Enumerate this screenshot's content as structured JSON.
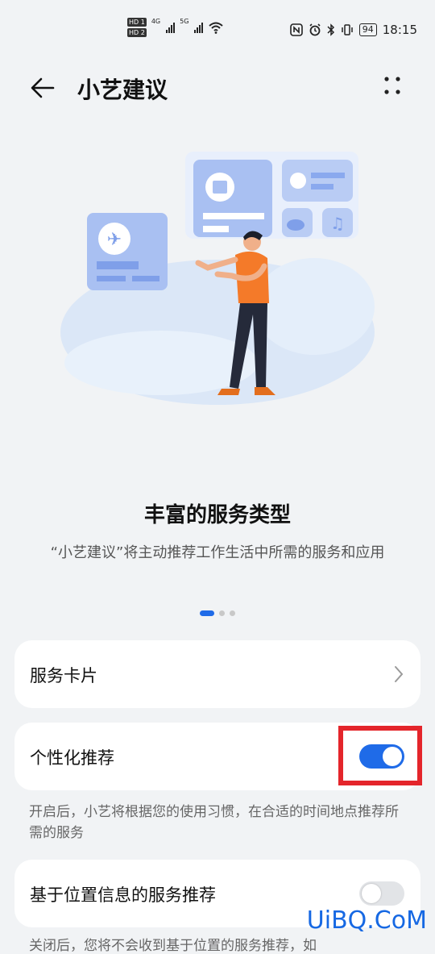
{
  "status_bar": {
    "hd1": "HD 1",
    "hd2": "HD 2",
    "net1": "4G",
    "net2": "5G",
    "battery": "94",
    "time": "18:15"
  },
  "header": {
    "title": "小艺建议"
  },
  "carousel": {
    "title": "丰富的服务类型",
    "description": "“小艺建议”将主动推荐工作生活中所需的服务和应用",
    "active_index": 0,
    "page_count": 3
  },
  "settings": {
    "service_cards_label": "服务卡片",
    "personalized_label": "个性化推荐",
    "personalized_on": true,
    "personalized_note": "开启后，小艺将根据您的使用习惯，在合适的时间地点推荐所需的服务",
    "location_label": "基于位置信息的服务推荐",
    "location_on": false,
    "location_note_partial": "关闭后，您将不会收到基于位置的服务推荐，如"
  },
  "watermark": "UiBQ.CoM",
  "colors": {
    "accent": "#1f6be8",
    "highlight": "#e4252b",
    "background": "#f1f3f5"
  }
}
